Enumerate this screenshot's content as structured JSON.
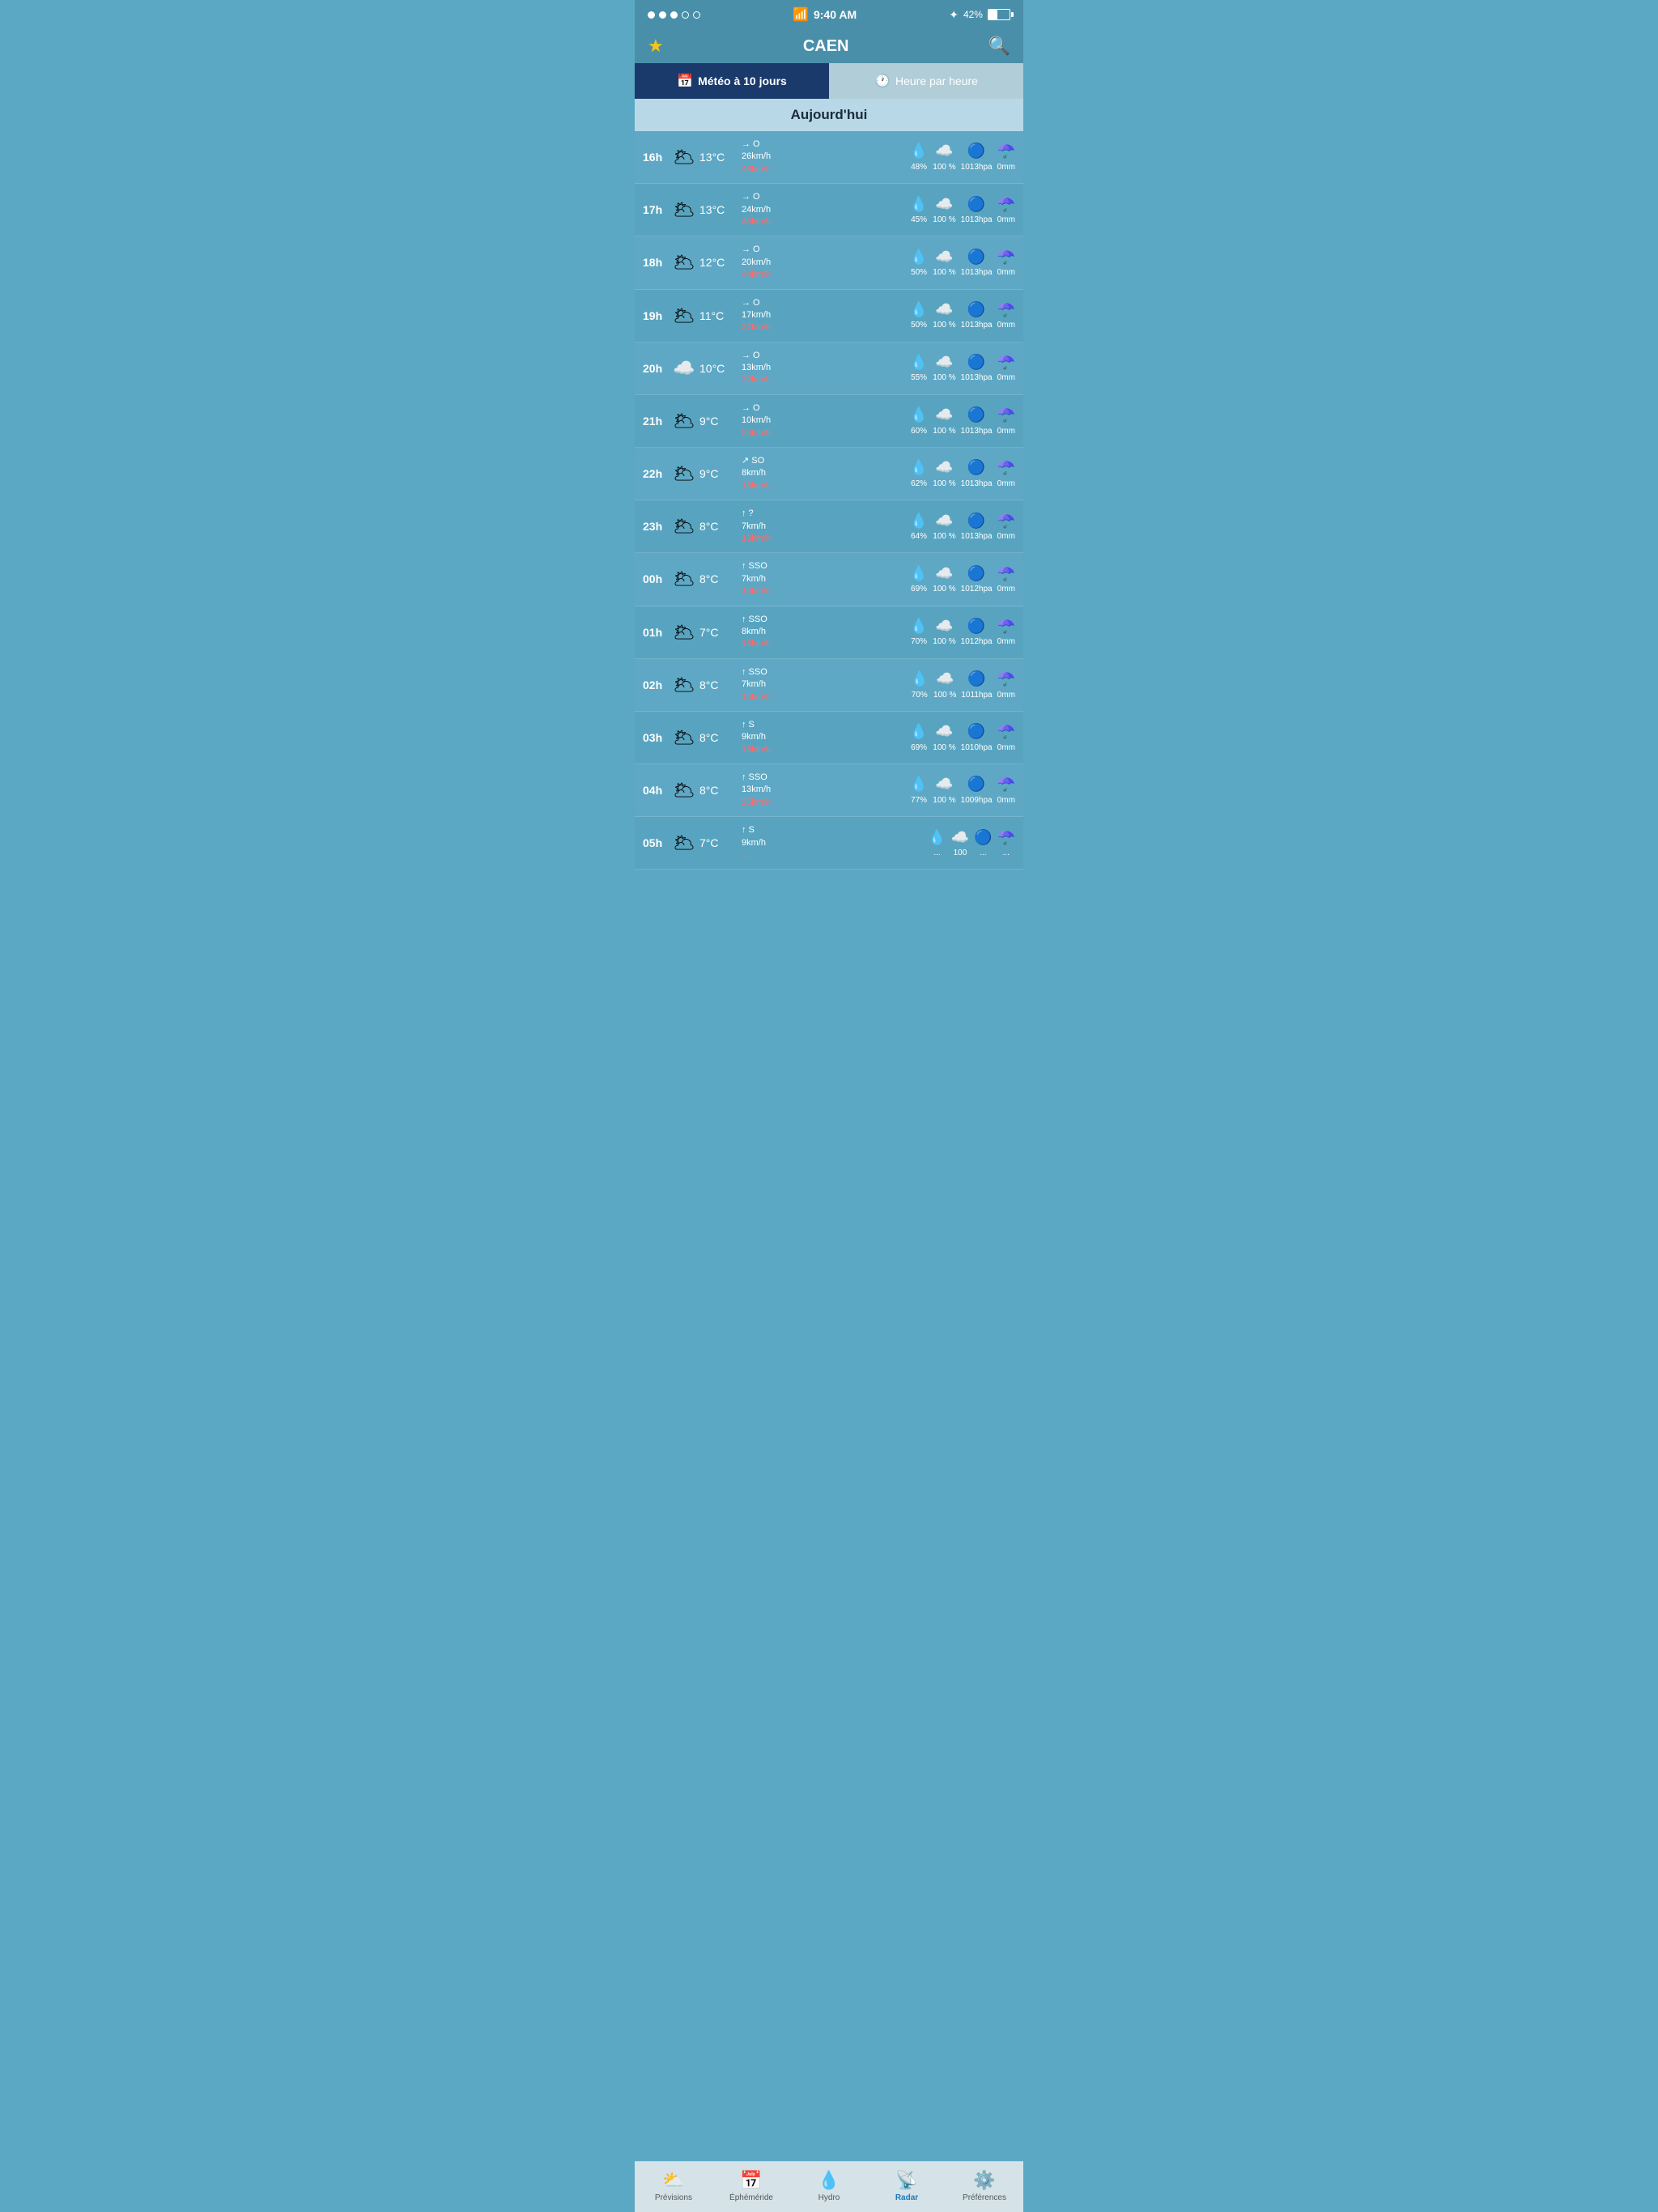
{
  "statusBar": {
    "time": "9:40 AM",
    "battery": "42%",
    "dots": [
      true,
      true,
      true,
      false,
      false
    ]
  },
  "header": {
    "title": "CAEN",
    "starIcon": "★",
    "searchIcon": "🔍"
  },
  "tabs": [
    {
      "id": "meteo",
      "label": "Météo à 10 jours",
      "icon": "📅",
      "active": true
    },
    {
      "id": "heure",
      "label": "Heure par heure",
      "icon": "🕐",
      "active": false
    }
  ],
  "dayHeader": "Aujourd'hui",
  "rows": [
    {
      "hour": "16h",
      "temp": "13°C",
      "windDir": "→ O",
      "windSpeed": "26km/h",
      "windGust": "48km/h",
      "humidity": "48%",
      "cloud": "100\n%",
      "pressure": "1013hpa",
      "rain": "0mm"
    },
    {
      "hour": "17h",
      "temp": "13°C",
      "windDir": "→ O",
      "windSpeed": "24km/h",
      "windGust": "48km/h",
      "humidity": "45%",
      "cloud": "100\n%",
      "pressure": "1013hpa",
      "rain": "0mm"
    },
    {
      "hour": "18h",
      "temp": "12°C",
      "windDir": "→ O",
      "windSpeed": "20km/h",
      "windGust": "44km/h",
      "humidity": "50%",
      "cloud": "100\n%",
      "pressure": "1013hpa",
      "rain": "0mm"
    },
    {
      "hour": "19h",
      "temp": "11°C",
      "windDir": "→ O",
      "windSpeed": "17km/h",
      "windGust": "37km/h",
      "humidity": "50%",
      "cloud": "100\n%",
      "pressure": "1013hpa",
      "rain": "0mm"
    },
    {
      "hour": "20h",
      "temp": "10°C",
      "windDir": "→ O",
      "windSpeed": "13km/h",
      "windGust": "32km/h",
      "humidity": "55%",
      "cloud": "100\n%",
      "pressure": "1013hpa",
      "rain": "0mm"
    },
    {
      "hour": "21h",
      "temp": "9°C",
      "windDir": "→ O",
      "windSpeed": "10km/h",
      "windGust": "24km/h",
      "humidity": "60%",
      "cloud": "100\n%",
      "pressure": "1013hpa",
      "rain": "0mm"
    },
    {
      "hour": "22h",
      "temp": "9°C",
      "windDir": "↗ SO",
      "windSpeed": "8km/h",
      "windGust": "18km/h",
      "humidity": "62%",
      "cloud": "100\n%",
      "pressure": "1013hpa",
      "rain": "0mm"
    },
    {
      "hour": "23h",
      "temp": "8°C",
      "windDir": "↑ ?",
      "windSpeed": "7km/h",
      "windGust": "13km/h",
      "humidity": "64%",
      "cloud": "100\n%",
      "pressure": "1013hpa",
      "rain": "0mm"
    },
    {
      "hour": "00h",
      "temp": "8°C",
      "windDir": "↑ SSO",
      "windSpeed": "7km/h",
      "windGust": "14km/h",
      "humidity": "69%",
      "cloud": "100\n%",
      "pressure": "1012hpa",
      "rain": "0mm"
    },
    {
      "hour": "01h",
      "temp": "7°C",
      "windDir": "↑ SSO",
      "windSpeed": "8km/h",
      "windGust": "15km/h",
      "humidity": "70%",
      "cloud": "100\n%",
      "pressure": "1012hpa",
      "rain": "0mm"
    },
    {
      "hour": "02h",
      "temp": "8°C",
      "windDir": "↑ SSO",
      "windSpeed": "7km/h",
      "windGust": "15km/h",
      "humidity": "70%",
      "cloud": "100\n%",
      "pressure": "1011hpa",
      "rain": "0mm"
    },
    {
      "hour": "03h",
      "temp": "8°C",
      "windDir": "↑ S",
      "windSpeed": "9km/h",
      "windGust": "16km/h",
      "humidity": "69%",
      "cloud": "100\n%",
      "pressure": "1010hpa",
      "rain": "0mm"
    },
    {
      "hour": "04h",
      "temp": "8°C",
      "windDir": "↑ SSO",
      "windSpeed": "13km/h",
      "windGust": "25km/h",
      "humidity": "77%",
      "cloud": "100\n%",
      "pressure": "1009hpa",
      "rain": "0mm"
    },
    {
      "hour": "05h",
      "temp": "7°C",
      "windDir": "↑ S",
      "windSpeed": "9km/h",
      "windGust": "...",
      "humidity": "...",
      "cloud": "100",
      "pressure": "...",
      "rain": "..."
    }
  ],
  "bottomNav": [
    {
      "id": "previsions",
      "label": "Prévisions",
      "icon": "🌤",
      "active": false
    },
    {
      "id": "ephemeride",
      "label": "Éphéméride",
      "icon": "📅",
      "active": false
    },
    {
      "id": "hydro",
      "label": "Hydro",
      "icon": "💧",
      "active": false
    },
    {
      "id": "radar",
      "label": "Radar",
      "icon": "📡",
      "active": true
    },
    {
      "id": "preferences",
      "label": "Préférences",
      "icon": "⚙️",
      "active": false
    }
  ]
}
